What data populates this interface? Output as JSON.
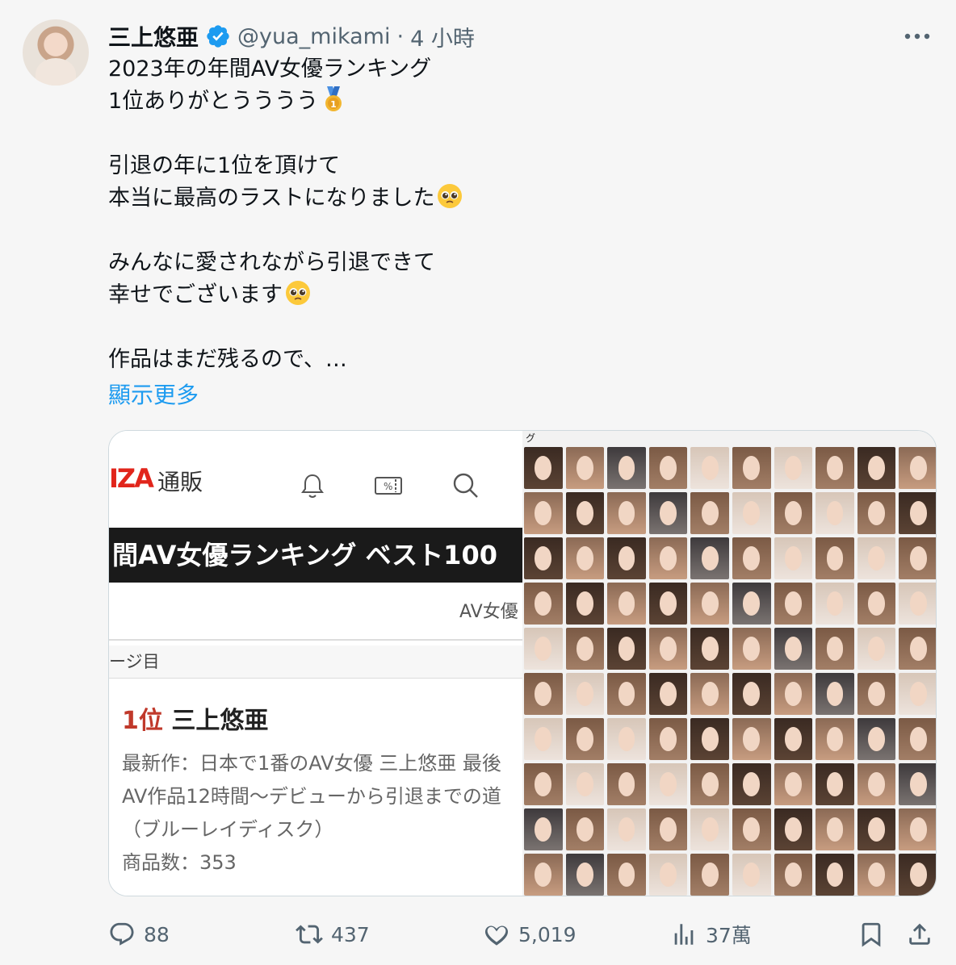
{
  "tweet": {
    "display_name": "三上悠亜",
    "handle": "@yua_mikami",
    "separator": "·",
    "time": "4 小時",
    "lines": [
      "2023年の年間AV女優ランキング",
      "1位ありがとうううう",
      "",
      "引退の年に1位を頂けて",
      "本当に最高のラストになりました",
      "",
      "みんなに愛されながら引退できて",
      "幸せでございます",
      "",
      "作品はまだ残るので、…"
    ],
    "show_more": "顯示更多"
  },
  "media": {
    "left": {
      "logo": "IZA",
      "shop": "通販",
      "ranking_title": "間AV女優ランキング ベスト100",
      "av_label": "AV女優",
      "page_label": "ージ目",
      "rank_number": "1位",
      "rank_name": "三上悠亜",
      "desc_lines": [
        "最新作：日本で1番のAV女優 三上悠亜 最後",
        "AV作品12時間〜デビューから引退までの道",
        "（ブルーレイディスク）",
        "商品数：353"
      ]
    },
    "right": {
      "grid_title": "グ",
      "face_count": 100
    }
  },
  "actions": {
    "reply_count": "88",
    "retweet_count": "437",
    "like_count": "5,019",
    "views_count": "37萬"
  },
  "icons": {
    "verified": "verified-badge-icon",
    "more": "more-dots-icon",
    "medal": "medal-emoji",
    "pleading": "pleading-face-emoji",
    "bell": "bell-icon",
    "coupon": "coupon-icon",
    "search": "search-icon",
    "reply": "reply-icon",
    "retweet": "retweet-icon",
    "like": "heart-icon",
    "views": "views-icon",
    "bookmark": "bookmark-icon",
    "share": "share-icon"
  },
  "colors": {
    "accent": "#1d9bf0",
    "text": "#0f1419",
    "muted": "#536471",
    "rank_red": "#c0392b",
    "logo_red": "#e1251b"
  }
}
